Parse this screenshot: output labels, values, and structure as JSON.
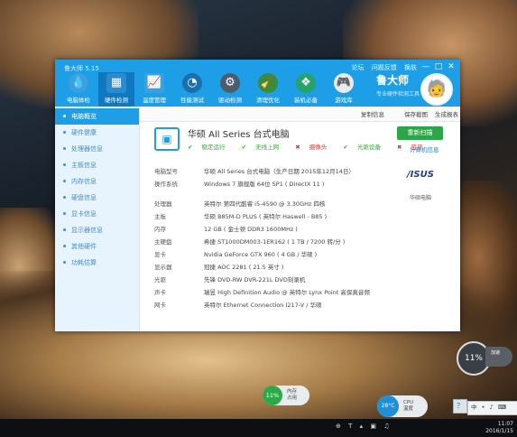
{
  "app": {
    "title": "鲁大师 5.15",
    "title_links": [
      "论坛",
      "问题反馈",
      "换肤"
    ],
    "window_controls": {
      "minimize": "—",
      "maximize": "□",
      "close": "✕"
    }
  },
  "toolbar": {
    "items": [
      {
        "label": "电脑体检",
        "icon": "💧"
      },
      {
        "label": "硬件检测",
        "icon": "▦"
      },
      {
        "label": "温度管理",
        "icon": "📈"
      },
      {
        "label": "性能测试",
        "icon": "◔"
      },
      {
        "label": "驱动检测",
        "icon": "⚙"
      },
      {
        "label": "清理优化",
        "icon": "🧹"
      },
      {
        "label": "装机必备",
        "icon": "❖"
      },
      {
        "label": "游戏库",
        "icon": "🎮"
      }
    ],
    "active_index": 1
  },
  "brand": {
    "name": "鲁大师",
    "subtitle": "专业硬件检测工具",
    "avatar": "🧓"
  },
  "subbar": {
    "copy_link": "复制信息",
    "save_link": "保存截图",
    "generate_link": "生成报表"
  },
  "sidebar": {
    "items": [
      "电脑概览",
      "硬件健康",
      "处理器信息",
      "主板信息",
      "内存信息",
      "硬盘信息",
      "显卡信息",
      "显示器信息",
      "其他硬件",
      "功耗估算"
    ],
    "active_index": 0
  },
  "summary": {
    "icon": "▣",
    "pc_name": "华硕 All Series 台式电脑",
    "checks": [
      {
        "mark": "✔",
        "label": "稳定运行",
        "ok": true
      },
      {
        "mark": "✔",
        "label": "无线上网",
        "ok": true
      },
      {
        "mark": "✖",
        "label": "摄像头",
        "ok": false
      },
      {
        "mark": "✔",
        "label": "光驱设备",
        "ok": true
      },
      {
        "mark": "✖",
        "label": "蓝牙",
        "ok": false
      }
    ],
    "detect_button": "重新扫描",
    "side_link": "计算机信息",
    "vendor_logo": "/ISUS",
    "vendor_label": "华硕电脑"
  },
  "specs": [
    {
      "key": "电脑型号",
      "value": "华硕 All Series 台式电脑（生产日期 2015年12月14日）"
    },
    {
      "key": "操作系统",
      "value": "Windows 7 旗舰版 64位 SP1 ( DirectX 11 )"
    },
    {
      "key": "",
      "value": ""
    },
    {
      "key": "处理器",
      "value": "英特尔 第四代酷睿 i5-4590 @ 3.30GHz 四核"
    },
    {
      "key": "主板",
      "value": "华硕 B85M-D PLUS ( 英特尔 Haswell - B85 )"
    },
    {
      "key": "内存",
      "value": "12 GB ( 金士顿 DDR3 1600MHz )"
    },
    {
      "key": "主硬盘",
      "value": "希捷 ST1000DM003-1ER162 ( 1 TB / 7200 转/分 )"
    },
    {
      "key": "显卡",
      "value": "Nvidia GeForce GTX 960 ( 4 GB / 华硕 )"
    },
    {
      "key": "显示器",
      "value": "冠捷 AOC 2281 ( 21.5 英寸 )"
    },
    {
      "key": "光驱",
      "value": "先锋 DVD-RW DVR-221L DVD刻录机"
    },
    {
      "key": "声卡",
      "value": "瑞昱 High Definition Audio @ 英特尔 Lynx Point 高保真音频"
    },
    {
      "key": "网卡",
      "value": "英特尔 Ethernet Connection I217-V / 华硕"
    }
  ],
  "widgets": {
    "w1": {
      "value": "11%",
      "line1": "内存",
      "line2": "占用"
    },
    "w2": {
      "value": "28°C",
      "line1": "CPU",
      "line2": "温度"
    },
    "w3": {
      "value": "11%",
      "mini": "加速"
    }
  },
  "tray": {
    "ime": "中",
    "dot": "•",
    "sym": "♪",
    "keyboard": "⌨",
    "help": "？"
  },
  "taskbar": {
    "icons": [
      "⊕",
      "T",
      "▴",
      "▣",
      "♫"
    ],
    "time": "11:07",
    "date": "2016/1/15"
  },
  "colors": {
    "accent": "#1e9ee6",
    "ok": "#35a53c",
    "bad": "#d9382f",
    "button": "#2fa54a"
  }
}
